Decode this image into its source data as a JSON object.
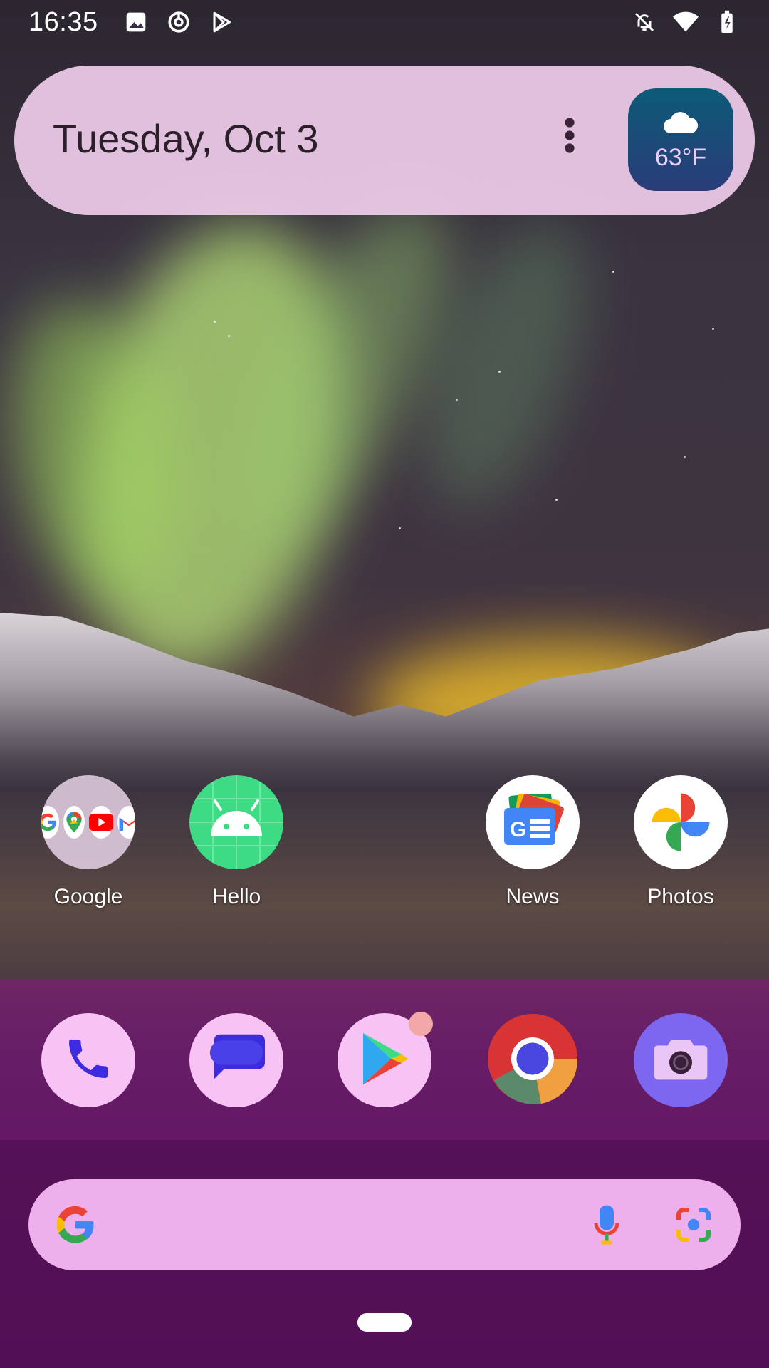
{
  "status_bar": {
    "time": "16:35",
    "left_icons": [
      "image-icon",
      "sync-icon",
      "play-store-outline-icon"
    ],
    "right_icons": [
      "notifications-off-icon",
      "wifi-icon",
      "battery-charging-icon"
    ]
  },
  "glance": {
    "date": "Tuesday, Oct 3",
    "weather": {
      "temp": "63°F",
      "icon": "cloud-icon"
    }
  },
  "apps": [
    {
      "label": "Google",
      "icon": "google-folder-icon"
    },
    {
      "label": "Hello",
      "icon": "android-icon"
    },
    {
      "label": "News",
      "icon": "google-news-icon"
    },
    {
      "label": "Photos",
      "icon": "google-photos-icon"
    }
  ],
  "dock": [
    {
      "name": "Phone",
      "icon": "phone-icon"
    },
    {
      "name": "Messages",
      "icon": "messages-icon"
    },
    {
      "name": "Play Store",
      "icon": "play-store-icon"
    },
    {
      "name": "Chrome",
      "icon": "chrome-icon"
    },
    {
      "name": "Camera",
      "icon": "camera-icon"
    }
  ],
  "search": {
    "icons": [
      "google-g-icon",
      "mic-icon",
      "lens-icon"
    ]
  },
  "colors": {
    "widget_bg": "#f0cdeb",
    "dock_bg": "#8c1482",
    "search_bg": "#f5b9f5",
    "weather_bg": "#0c5a78"
  }
}
